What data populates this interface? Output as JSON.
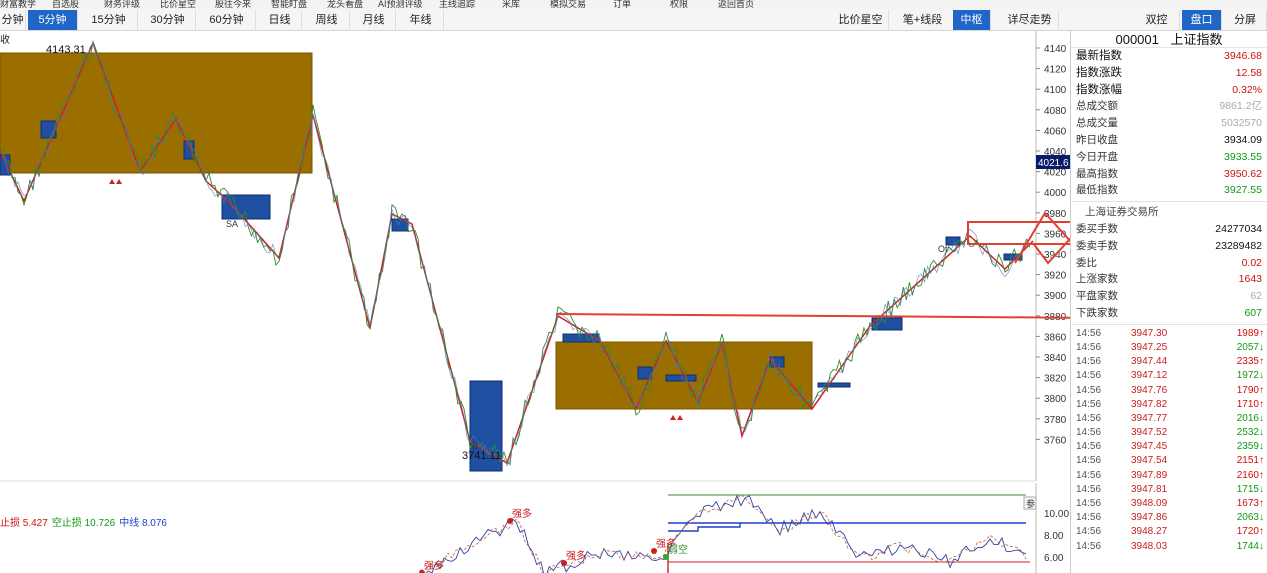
{
  "top_menu": [
    "财富教学",
    "自选股",
    "财务评级",
    "比价星空",
    "股往今来",
    "智能盯盘",
    "龙头看盘",
    "AI预测评级",
    "主线追踪",
    "米库",
    "模拟交易",
    "订单",
    "权限",
    "返回首页"
  ],
  "period_tabs": [
    "分钟",
    "5分钟",
    "15分钟",
    "30分钟",
    "60分钟",
    "日线",
    "周线",
    "月线",
    "年线"
  ],
  "active_period": "5分钟",
  "tool_tabs": [
    "比价星空",
    "笔+线段",
    "中枢",
    "详尽走势"
  ],
  "active_tool": "中枢",
  "panel_tabs": [
    "双控",
    "盘口",
    "分屏"
  ],
  "active_panel_tab": "盘口",
  "left_edge_text": "收",
  "stock": {
    "code": "000001",
    "name": "上证指数"
  },
  "quote": [
    {
      "label": "最新指数",
      "value": "3946.68",
      "color": "red",
      "big": true
    },
    {
      "label": "指数涨跌",
      "value": "12.58",
      "color": "red",
      "big": true
    },
    {
      "label": "指数涨幅",
      "value": "0.32%",
      "color": "red",
      "big": true
    },
    {
      "label": "总成交额",
      "value": "9861.2亿",
      "color": "gray",
      "big": false
    },
    {
      "label": "总成交量",
      "value": "5032570",
      "color": "gray",
      "big": false
    },
    {
      "label": "昨日收盘",
      "value": "3934.09",
      "color": "blk",
      "big": false
    },
    {
      "label": "今日开盘",
      "value": "3933.55",
      "color": "green",
      "big": false
    },
    {
      "label": "最高指数",
      "value": "3950.62",
      "color": "red",
      "big": false
    },
    {
      "label": "最低指数",
      "value": "3927.55",
      "color": "green",
      "big": false
    }
  ],
  "exchange_label": "上海证券交易所",
  "quote2": [
    {
      "label": "委买手数",
      "value": "24277034",
      "color": "blk"
    },
    {
      "label": "委卖手数",
      "value": "23289482",
      "color": "blk"
    },
    {
      "label": "委比",
      "value": "0.02",
      "color": "red"
    },
    {
      "label": "上涨家数",
      "value": "1643",
      "color": "red"
    },
    {
      "label": "平盘家数",
      "value": "62",
      "color": "gray"
    },
    {
      "label": "下跌家数",
      "value": "607",
      "color": "green"
    }
  ],
  "ticks": [
    {
      "time": "14:56",
      "price": "3947.30",
      "vol": "1989↑",
      "dir": "up"
    },
    {
      "time": "14:56",
      "price": "3947.25",
      "vol": "2057↓",
      "dir": "down"
    },
    {
      "time": "14:56",
      "price": "3947.44",
      "vol": "2335↑",
      "dir": "up"
    },
    {
      "time": "14:56",
      "price": "3947.12",
      "vol": "1972↓",
      "dir": "down"
    },
    {
      "time": "14:56",
      "price": "3947.76",
      "vol": "1790↑",
      "dir": "up"
    },
    {
      "time": "14:56",
      "price": "3947.82",
      "vol": "1710↑",
      "dir": "up"
    },
    {
      "time": "14:56",
      "price": "3947.77",
      "vol": "2016↓",
      "dir": "down"
    },
    {
      "time": "14:56",
      "price": "3947.52",
      "vol": "2532↓",
      "dir": "down"
    },
    {
      "time": "14:56",
      "price": "3947.45",
      "vol": "2359↓",
      "dir": "down"
    },
    {
      "time": "14:56",
      "price": "3947.54",
      "vol": "2151↑",
      "dir": "up"
    },
    {
      "time": "14:56",
      "price": "3947.89",
      "vol": "2160↑",
      "dir": "up"
    },
    {
      "time": "14:56",
      "price": "3947.81",
      "vol": "1715↓",
      "dir": "down"
    },
    {
      "time": "14:56",
      "price": "3948.09",
      "vol": "1673↑",
      "dir": "up"
    },
    {
      "time": "14:56",
      "price": "3947.86",
      "vol": "2063↓",
      "dir": "down"
    },
    {
      "time": "14:56",
      "price": "3948.27",
      "vol": "1720↑",
      "dir": "up"
    },
    {
      "time": "14:56",
      "price": "3948.03",
      "vol": "1744↓",
      "dir": "down"
    }
  ],
  "chart_labels": {
    "high_label": "4143.31",
    "low_label": "3741.11",
    "current_price_tag": "4021.6",
    "sa_label": "SA",
    "b_label": "B",
    "ot_label": "Ot"
  },
  "price_axis": [
    "4140",
    "4120",
    "4100",
    "4080",
    "4060",
    "4040",
    "4020",
    "4000",
    "3980",
    "3960",
    "3940",
    "3920",
    "3900",
    "3880",
    "3860",
    "3840",
    "3820",
    "3800",
    "3780",
    "3760"
  ],
  "indicator_legend": [
    {
      "text": "止损 5.427",
      "color": "#d01010"
    },
    {
      "text": "空止损 10.726",
      "color": "#119911"
    },
    {
      "text": "中线 8.076",
      "color": "#1f3fc8"
    }
  ],
  "indicator_axis": [
    "10.00",
    "8.00",
    "6.00"
  ],
  "indicator_labels": [
    "强多",
    "强多",
    "强多",
    "强多",
    "弱空",
    "参"
  ],
  "colors": {
    "accent": "#1f66c8",
    "zone_fill": "#9a6f00",
    "zone_border": "#d02020",
    "up": "#d01010",
    "down": "#119911"
  }
}
